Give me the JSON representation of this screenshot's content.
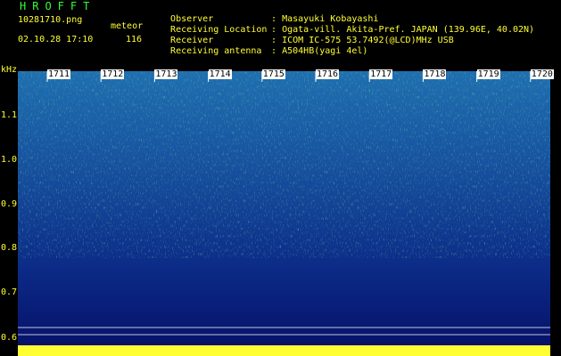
{
  "header": {
    "title": "HROFFT",
    "filename": "10281710.png",
    "datetime": "02.10.28 17:10",
    "meteor_label": "meteor",
    "meteor_count": "116"
  },
  "info": [
    {
      "key": "Observer",
      "value": ": Masayuki Kobayashi"
    },
    {
      "key": "Receiving Location",
      "value": ": Ogata-vill. Akita-Pref. JAPAN (139.96E, 40.02N)"
    },
    {
      "key": "Receiver",
      "value": ": ICOM IC-575 53.7492(@LCD)MHz USB"
    },
    {
      "key": "Receiving antenna",
      "value": ": A504HB(yagi 4el)"
    }
  ],
  "spectrogram": {
    "y_unit": "kHz",
    "y_ticks": [
      "1.1",
      "1.0",
      "0.9",
      "0.8",
      "0.7",
      "0.6"
    ],
    "x_ticks": [
      "1711",
      "1712",
      "1713",
      "1714",
      "1715",
      "1716",
      "1717",
      "1718",
      "1719",
      "1720"
    ]
  }
}
